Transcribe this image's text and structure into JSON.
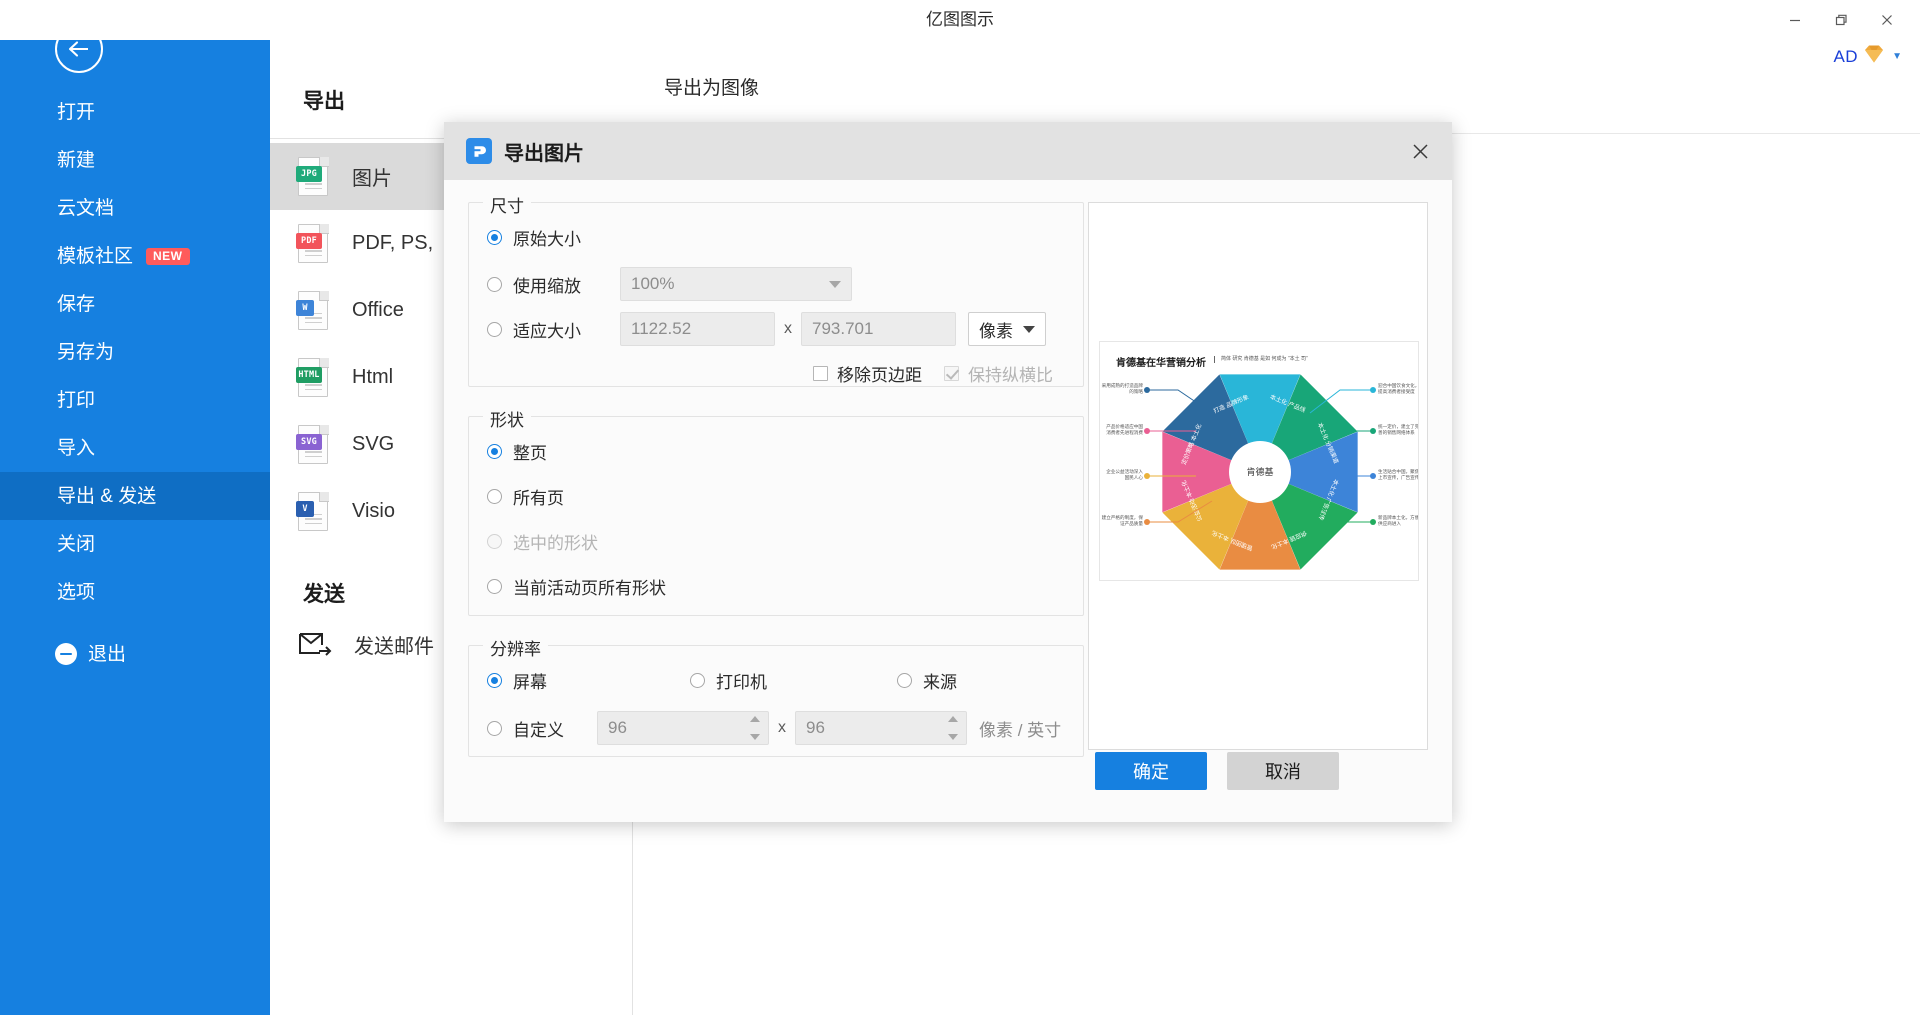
{
  "window": {
    "title": "亿图图示",
    "minimize_icon": "minimize-icon",
    "restore_icon": "restore-icon",
    "close_icon": "close-icon"
  },
  "account": {
    "name": "AD",
    "vip_icon": "vip-diamond-icon",
    "caret_icon": "chevron-down-icon"
  },
  "sidebar": {
    "back_icon": "back-arrow-icon",
    "items": [
      {
        "label": "打开",
        "name": "sidebar-item-open",
        "active": false,
        "badge": ""
      },
      {
        "label": "新建",
        "name": "sidebar-item-new",
        "active": false,
        "badge": ""
      },
      {
        "label": "云文档",
        "name": "sidebar-item-cloud-docs",
        "active": false,
        "badge": ""
      },
      {
        "label": "模板社区",
        "name": "sidebar-item-templates",
        "active": false,
        "badge": "NEW"
      },
      {
        "label": "保存",
        "name": "sidebar-item-save",
        "active": false,
        "badge": ""
      },
      {
        "label": "另存为",
        "name": "sidebar-item-save-as",
        "active": false,
        "badge": ""
      },
      {
        "label": "打印",
        "name": "sidebar-item-print",
        "active": false,
        "badge": ""
      },
      {
        "label": "导入",
        "name": "sidebar-item-import",
        "active": false,
        "badge": ""
      },
      {
        "label": "导出 & 发送",
        "name": "sidebar-item-export-send",
        "active": true,
        "badge": ""
      },
      {
        "label": "关闭",
        "name": "sidebar-item-close",
        "active": false,
        "badge": ""
      },
      {
        "label": "选项",
        "name": "sidebar-item-options",
        "active": false,
        "badge": ""
      }
    ],
    "exit": {
      "label": "退出",
      "icon": "exit-icon"
    }
  },
  "export_panel": {
    "heading": "导出",
    "formats": [
      {
        "label": "图片",
        "tag": "JPG",
        "color": "#1faa7a",
        "selected": true
      },
      {
        "label": "PDF, PS,",
        "tag": "PDF",
        "color": "#f2545b",
        "selected": false
      },
      {
        "label": "Office",
        "tag": "W",
        "color": "#3d84d8",
        "selected": false
      },
      {
        "label": "Html",
        "tag": "HTML",
        "color": "#1f9d63",
        "selected": false
      },
      {
        "label": "SVG",
        "tag": "SVG",
        "color": "#8a63d2",
        "selected": false
      },
      {
        "label": "Visio",
        "tag": "V",
        "color": "#2a5fb0",
        "selected": false
      }
    ],
    "send_heading": "发送",
    "send_items": [
      {
        "label": "发送邮件",
        "icon": "mail-send-icon"
      }
    ]
  },
  "content": {
    "export_as_image_heading": "导出为图像"
  },
  "dialog": {
    "logo_icon": "eddx-logo-icon",
    "title": "导出图片",
    "close_icon": "close-icon",
    "size": {
      "legend": "尺寸",
      "original_label": "原始大小",
      "original_selected": true,
      "scale_label": "使用缩放",
      "scale_selected": false,
      "scale_value": "100%",
      "fit_label": "适应大小",
      "fit_selected": false,
      "width_value": "1122.52",
      "height_value": "793.701",
      "x_separator": "x",
      "unit_value": "像素",
      "remove_margin_label": "移除页边距",
      "remove_margin_checked": false,
      "keep_ratio_label": "保持纵横比",
      "keep_ratio_checked": true,
      "keep_ratio_disabled": true
    },
    "shape": {
      "legend": "形状",
      "options": [
        {
          "label": "整页",
          "selected": true,
          "disabled": false
        },
        {
          "label": "所有页",
          "selected": false,
          "disabled": false
        },
        {
          "label": "选中的形状",
          "selected": false,
          "disabled": true
        },
        {
          "label": "当前活动页所有形状",
          "selected": false,
          "disabled": false
        }
      ]
    },
    "resolution": {
      "legend": "分辨率",
      "options": [
        {
          "label": "屏幕",
          "selected": true
        },
        {
          "label": "打印机",
          "selected": false
        },
        {
          "label": "来源",
          "selected": false
        }
      ],
      "custom_label": "自定义",
      "custom_selected": false,
      "dpi_x": "96",
      "dpi_y": "96",
      "x_separator": "x",
      "unit_label": "像素 / 英寸"
    },
    "preview": {
      "thumb_title": "肯德基在华营销分析",
      "thumb_subtitle": "简体 研究 肯德基 是如 何成为 “本土 司”",
      "center_label": "肯德基",
      "wedges": [
        {
          "text": "本土化\n产品线",
          "color": "#29b6d8"
        },
        {
          "text": "本土化\n分销渠道",
          "color": "#18a678"
        },
        {
          "text": "本土化\n广告宣传",
          "color": "#3d84d8"
        },
        {
          "text": "供应链\n本土化",
          "color": "#22ac5e"
        },
        {
          "text": "管理团队\n本土化",
          "color": "#e98c42"
        },
        {
          "text": "公益活动\n本土化",
          "color": "#eab23a"
        },
        {
          "text": "定价策略\n本土化",
          "color": "#ea5f93"
        },
        {
          "text": "打造\n品牌形象",
          "color": "#2c6a9e"
        }
      ],
      "callouts_left": [
        {
          "text": "采用成熟的打造品牌\n的策略",
          "color": "#2c6a9e"
        },
        {
          "text": "产品价格适应中国\n消费者先进程消费",
          "color": "#ea5f93"
        },
        {
          "text": "企业公益活动深入\n国民人心",
          "color": "#eab23a"
        },
        {
          "text": "建立严格的制度，保\n证产品质量",
          "color": "#e98c42"
        }
      ],
      "callouts_right": [
        {
          "text": "迎合中国饮食文化，\n提高消费者接受度",
          "color": "#29b6d8"
        },
        {
          "text": "统一定价，建立了完\n善的销售网络体系",
          "color": "#18a678"
        },
        {
          "text": "生活贴合中国，聚焦\n上市宣传，广告宣传",
          "color": "#3d84d8"
        },
        {
          "text": "新品牌本土化，方便\n供应商进入",
          "color": "#22ac5e"
        }
      ]
    },
    "buttons": {
      "ok": "确定",
      "cancel": "取消"
    }
  }
}
